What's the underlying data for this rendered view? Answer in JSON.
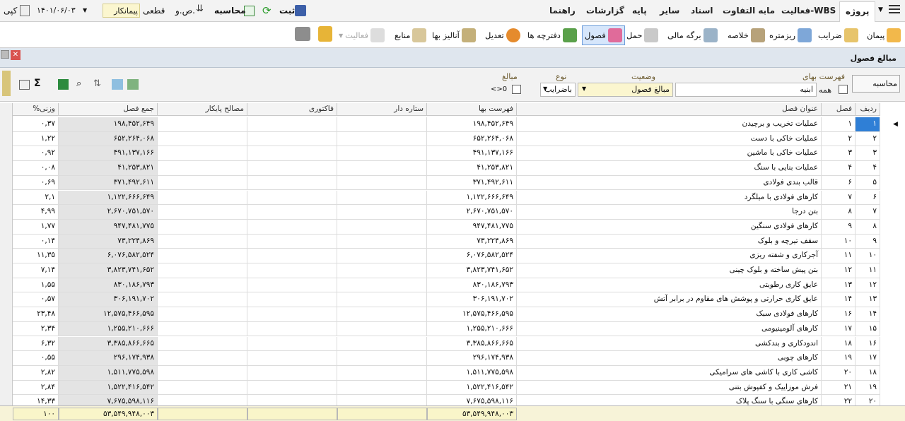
{
  "menubar": {
    "items": [
      "پروژه",
      "فعالیت-WBS",
      "مابه التفاوت",
      "اسناد",
      "سایر",
      "پایه",
      "گزارشات",
      "راهنما"
    ],
    "save_label": "ثبت",
    "calc_label": "محاسبه",
    "mode_label": "ص.و.",
    "final_label": "قطعی",
    "contractor_label": "پیمانکار",
    "date_value": "۱۴۰۱/۰۶/۰۳",
    "copy_label": "کپی"
  },
  "toolbar": {
    "items": [
      "پیمان",
      "ضرایب",
      "ریزمتره",
      "خلاصه",
      "برگه مالی",
      "حمل",
      "فصول",
      "دفترچه ها",
      "تعدیل",
      "آنالیز بها",
      "منابع",
      "فعالیت"
    ]
  },
  "window": {
    "title": "مبالغ فصول"
  },
  "filters": {
    "price_list_label": "فهرست بهای",
    "price_list_value": "ابنیه",
    "all_label": "همه",
    "status_label": "وضعیت",
    "status_value": "مبالغ فصول",
    "type_label": "نوع",
    "type_value": "باضرایب",
    "amounts_label": "مبالغ",
    "amounts_value": "<>0",
    "calc_button": "محاسبه"
  },
  "table": {
    "columns": [
      "ردیف",
      "فصل",
      "عنوان فصل",
      "فهرست بها",
      "ستاره دار",
      "فاکتوری",
      "مصالح پایکار",
      "جمع فصل",
      "%وزنی"
    ],
    "rows": [
      [
        "۱",
        "۱",
        "عملیات تخریب و برچیدن",
        "۱۹۸,۴۵۲,۶۴۹",
        "",
        "",
        "",
        "۱۹۸,۴۵۲,۶۴۹",
        "۰,۳۷"
      ],
      [
        "۲",
        "۲",
        "عملیات خاکی با دست",
        "۶۵۲,۲۶۴,۰۶۸",
        "",
        "",
        "",
        "۶۵۲,۲۶۴,۰۶۸",
        "۱,۲۲"
      ],
      [
        "۳",
        "۳",
        "عملیات خاکی با ماشین",
        "۴۹۱,۱۳۷,۱۶۶",
        "",
        "",
        "",
        "۴۹۱,۱۳۷,۱۶۶",
        "۰,۹۲"
      ],
      [
        "۴",
        "۴",
        "عملیات بنایی با سنگ",
        "۴۱,۲۵۳,۸۲۱",
        "",
        "",
        "",
        "۴۱,۲۵۳,۸۲۱",
        "۰,۰۸"
      ],
      [
        "۵",
        "۶",
        "قالب بندی فولادی",
        "۳۷۱,۴۹۲,۶۱۱",
        "",
        "",
        "",
        "۳۷۱,۴۹۲,۶۱۱",
        "۰,۶۹"
      ],
      [
        "۶",
        "۷",
        "کارهای فولادی با میلگرد",
        "۱,۱۲۲,۶۶۶,۶۴۹",
        "",
        "",
        "",
        "۱,۱۲۲,۶۶۶,۶۴۹",
        "۲,۱"
      ],
      [
        "۷",
        "۸",
        "بتن درجا",
        "۲,۶۷۰,۷۵۱,۵۷۰",
        "",
        "",
        "",
        "۲,۶۷۰,۷۵۱,۵۷۰",
        "۴,۹۹"
      ],
      [
        "۸",
        "۹",
        "کارهای فولادی سنگین",
        "۹۴۷,۴۸۱,۷۷۵",
        "",
        "",
        "",
        "۹۴۷,۴۸۱,۷۷۵",
        "۱,۷۷"
      ],
      [
        "۹",
        "۱۰",
        "سقف تیرچه و بلوک",
        "۷۳,۲۲۴,۸۶۹",
        "",
        "",
        "",
        "۷۳,۲۲۴,۸۶۹",
        "۰,۱۴"
      ],
      [
        "۱۰",
        "۱۱",
        "آجرکاری و شفته ریزی",
        "۶,۰۷۶,۵۸۲,۵۲۴",
        "",
        "",
        "",
        "۶,۰۷۶,۵۸۲,۵۲۴",
        "۱۱,۳۵"
      ],
      [
        "۱۱",
        "۱۲",
        "بتن پیش ساخته و بلوک چینی",
        "۳,۸۲۳,۷۴۱,۶۵۲",
        "",
        "",
        "",
        "۳,۸۲۳,۷۴۱,۶۵۲",
        "۷,۱۴"
      ],
      [
        "۱۲",
        "۱۳",
        "عایق کاری رطوبتی",
        "۸۳۰,۱۸۶,۷۹۳",
        "",
        "",
        "",
        "۸۳۰,۱۸۶,۷۹۳",
        "۱,۵۵"
      ],
      [
        "۱۳",
        "۱۴",
        "عایق کاری حرارتی و پوشش های مقاوم در برابر آتش",
        "۳۰۶,۱۹۱,۷۰۲",
        "",
        "",
        "",
        "۳۰۶,۱۹۱,۷۰۲",
        "۰,۵۷"
      ],
      [
        "۱۴",
        "۱۶",
        "کارهای فولادی سبک",
        "۱۲,۵۷۵,۴۶۶,۵۹۵",
        "",
        "",
        "",
        "۱۲,۵۷۵,۴۶۶,۵۹۵",
        "۲۳,۴۸"
      ],
      [
        "۱۵",
        "۱۷",
        "کارهای آلومینیومی",
        "۱,۲۵۵,۲۱۰,۶۶۶",
        "",
        "",
        "",
        "۱,۲۵۵,۲۱۰,۶۶۶",
        "۲,۳۴"
      ],
      [
        "۱۶",
        "۱۸",
        "اندودکاری و بندکشی",
        "۳,۳۸۵,۸۶۶,۶۶۵",
        "",
        "",
        "",
        "۳,۳۸۵,۸۶۶,۶۶۵",
        "۶,۳۲"
      ],
      [
        "۱۷",
        "۱۹",
        "کارهای چوبی",
        "۲۹۶,۱۷۴,۹۳۸",
        "",
        "",
        "",
        "۲۹۶,۱۷۴,۹۳۸",
        "۰,۵۵"
      ],
      [
        "۱۸",
        "۲۰",
        "کاشی کاری با کاشی های سرامیکی",
        "۱,۵۱۱,۷۷۵,۵۹۸",
        "",
        "",
        "",
        "۱,۵۱۱,۷۷۵,۵۹۸",
        "۲,۸۲"
      ],
      [
        "۱۹",
        "۲۱",
        "فرش موزاییک و کفپوش بتنی",
        "۱,۵۲۲,۴۱۶,۵۴۲",
        "",
        "",
        "",
        "۱,۵۲۲,۴۱۶,۵۴۲",
        "۲,۸۴"
      ],
      [
        "۲۰",
        "۲۲",
        "کارهای سنگی با سنگ پلاک",
        "۷,۶۷۵,۵۹۸,۱۱۶",
        "",
        "",
        "",
        "۷,۶۷۵,۵۹۸,۱۱۶",
        "۱۴,۳۳"
      ]
    ]
  },
  "totals": {
    "price_list": "۵۳,۵۴۹,۹۴۸,۰۰۳",
    "sum": "۵۳,۵۴۹,۹۴۸,۰۰۳",
    "weight": "۱۰۰"
  },
  "colors": {
    "accent": "#2f7fd6",
    "header_bg": "#dfe6ee",
    "gray_cell": "#e4e4e4",
    "total_bg": "#f9f5c9"
  }
}
